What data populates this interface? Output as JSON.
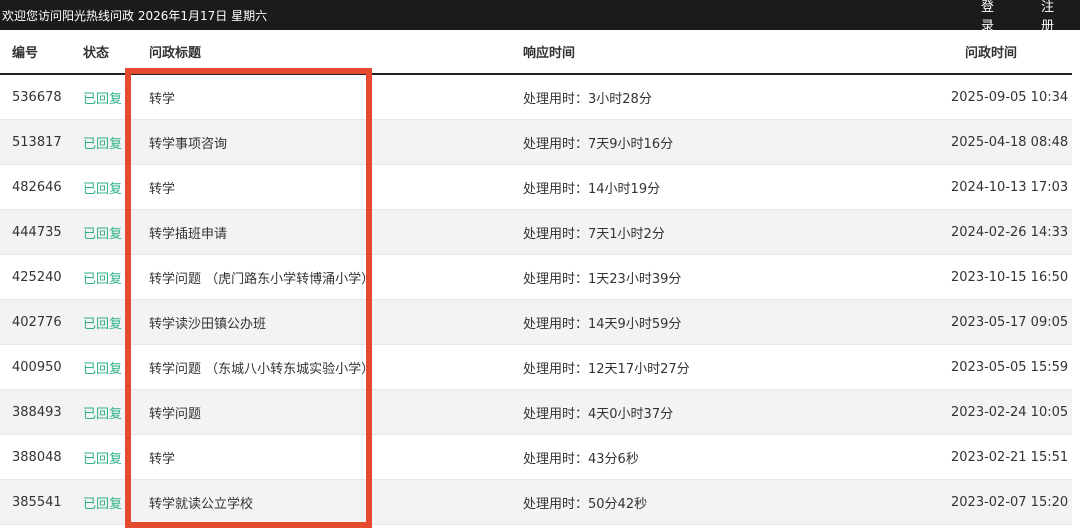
{
  "topbar": {
    "welcome": "欢迎您访问阳光热线问政  2026年1月17日  星期六",
    "login_label": "登录",
    "register_label": "注册"
  },
  "table": {
    "headers": {
      "id": "编号",
      "status": "状态",
      "title": "问政标题",
      "response": "响应时间",
      "time": "问政时间"
    },
    "rows": [
      {
        "id": "536678",
        "status": "已回复",
        "title": "转学",
        "response": "处理用时：3小时28分",
        "time": "2025-09-05 10:34"
      },
      {
        "id": "513817",
        "status": "已回复",
        "title": "转学事项咨询",
        "response": "处理用时：7天9小时16分",
        "time": "2025-04-18 08:48"
      },
      {
        "id": "482646",
        "status": "已回复",
        "title": "转学",
        "response": "处理用时：14小时19分",
        "time": "2024-10-13 17:03"
      },
      {
        "id": "444735",
        "status": "已回复",
        "title": "转学插班申请",
        "response": "处理用时：7天1小时2分",
        "time": "2024-02-26 14:33"
      },
      {
        "id": "425240",
        "status": "已回复",
        "title": "转学问题 （虎门路东小学转博涌小学）",
        "response": "处理用时：1天23小时39分",
        "time": "2023-10-15 16:50"
      },
      {
        "id": "402776",
        "status": "已回复",
        "title": "转学读沙田镇公办班",
        "response": "处理用时：14天9小时59分",
        "time": "2023-05-17 09:05"
      },
      {
        "id": "400950",
        "status": "已回复",
        "title": "转学问题 （东城八小转东城实验小学）",
        "response": "处理用时：12天17小时27分",
        "time": "2023-05-05 15:59"
      },
      {
        "id": "388493",
        "status": "已回复",
        "title": "转学问题",
        "response": "处理用时：4天0小时37分",
        "time": "2023-02-24 10:05"
      },
      {
        "id": "388048",
        "status": "已回复",
        "title": "转学",
        "response": "处理用时：43分6秒",
        "time": "2023-02-21 15:51"
      },
      {
        "id": "385541",
        "status": "已回复",
        "title": "转学就读公立学校",
        "response": "处理用时：50分42秒",
        "time": "2023-02-07 15:20"
      }
    ]
  },
  "colors": {
    "topbar_bg": "#1b1b1b",
    "status_green": "#2fb08a",
    "highlight_red": "#e64a2e"
  }
}
